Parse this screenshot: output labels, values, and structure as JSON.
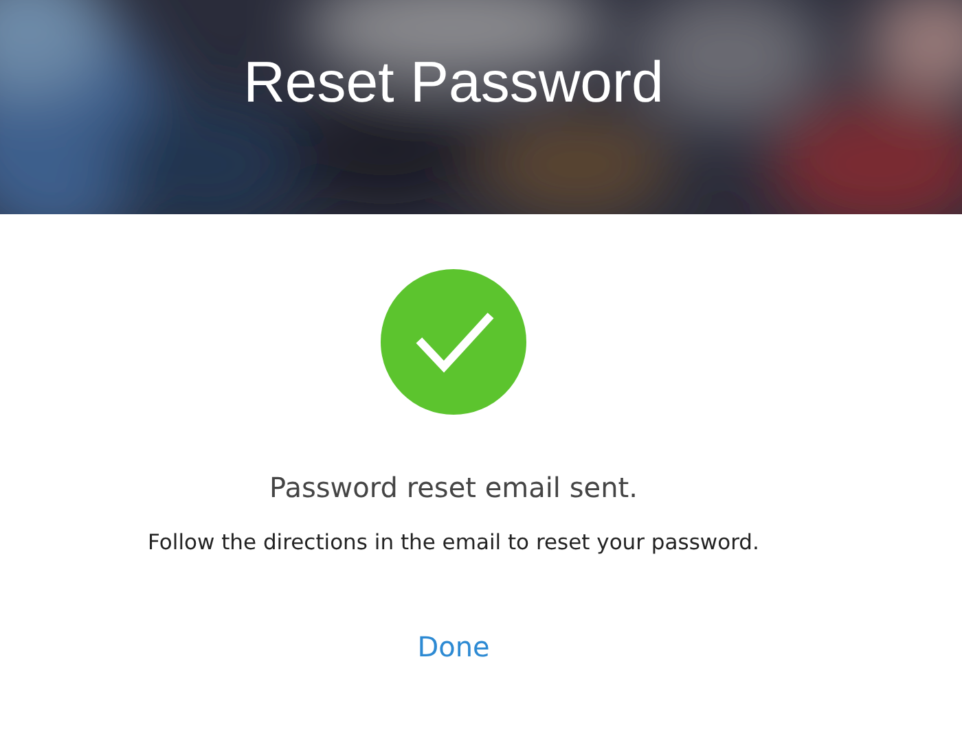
{
  "header": {
    "title": "Reset Password"
  },
  "status": {
    "kind": "success",
    "message": "Password reset email sent.",
    "details": "Follow the directions in the email to reset your password."
  },
  "actions": [
    {
      "label": "Done"
    }
  ]
}
